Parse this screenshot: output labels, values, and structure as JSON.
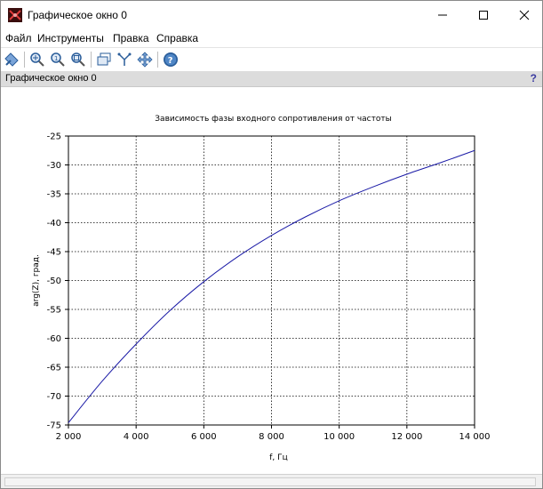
{
  "window": {
    "title": "Графическое окно 0"
  },
  "menu": [
    "Файл",
    "Инструменты",
    "Правка",
    "Справка"
  ],
  "toolbar": {
    "icons": [
      "rotate-icon",
      "zoom-in-icon",
      "zoom-original-icon",
      "zoom-fit-icon",
      "select-figure-icon",
      "datatip-icon",
      "pan-icon",
      "help-icon"
    ]
  },
  "infobar": {
    "label": "Графическое окно 0",
    "help": "?"
  },
  "chart_data": {
    "type": "line",
    "title": "Зависимость фазы входного сопротивления от частоты",
    "xlabel": "f, Гц",
    "ylabel": "arg(Z), град.",
    "xlim": [
      2000,
      14000
    ],
    "ylim": [
      -75,
      -25
    ],
    "grid": true,
    "x_ticks": [
      2000,
      4000,
      6000,
      8000,
      10000,
      12000,
      14000
    ],
    "x_tick_labels": [
      "2 000",
      "4 000",
      "6 000",
      "8 000",
      "10 000",
      "12 000",
      "14 000"
    ],
    "y_ticks": [
      -75,
      -70,
      -65,
      -60,
      -55,
      -50,
      -45,
      -40,
      -35,
      -30,
      -25
    ],
    "y_tick_labels": [
      "-75",
      "-70",
      "-65",
      "-60",
      "-55",
      "-50",
      "-45",
      "-40",
      "-35",
      "-30",
      "-25"
    ],
    "series": [
      {
        "color": "#1a1aa6",
        "x": [
          2000,
          3000,
          4000,
          5000,
          6000,
          7000,
          8000,
          9000,
          10000,
          11000,
          12000,
          13000,
          14000
        ],
        "y": [
          -74.6,
          -67.4,
          -61.0,
          -55.2,
          -50.2,
          -45.9,
          -42.2,
          -39.0,
          -36.2,
          -33.8,
          -31.6,
          -29.6,
          -27.5
        ]
      }
    ]
  }
}
